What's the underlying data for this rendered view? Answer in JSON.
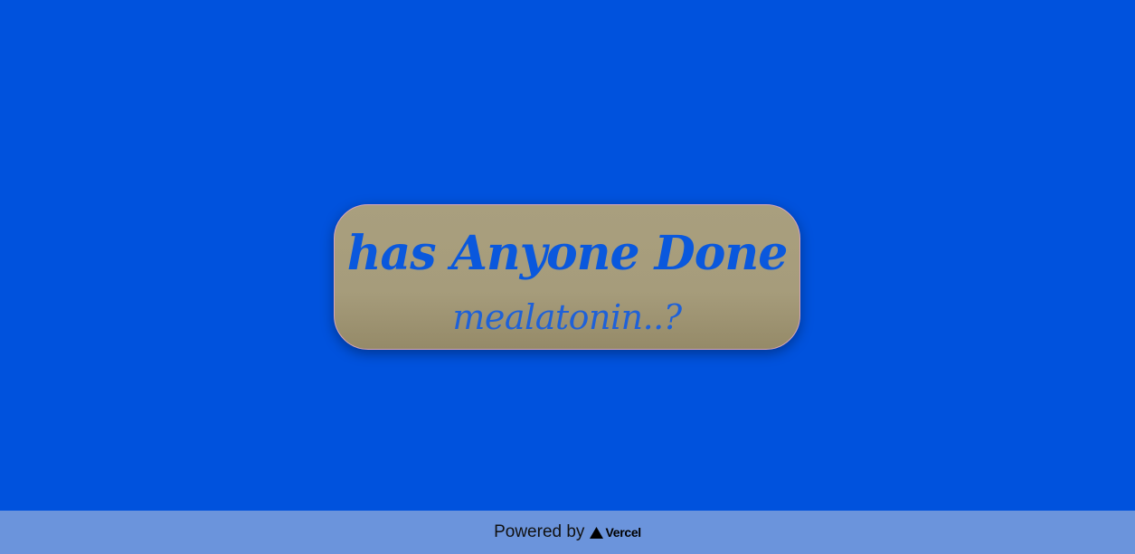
{
  "card": {
    "title": "has Anyone Done",
    "subtitle": "mealatonin..?"
  },
  "footer": {
    "powered_by": "Powered by",
    "brand": "Vercel"
  },
  "colors": {
    "page_background": "#0052dd",
    "card_background": "#a69c7b",
    "card_border": "#d9a6b8",
    "text_accent": "#0a58dd",
    "footer_background": "#6b94dc"
  },
  "icons": {
    "brand_logo": "vercel-triangle-icon"
  }
}
